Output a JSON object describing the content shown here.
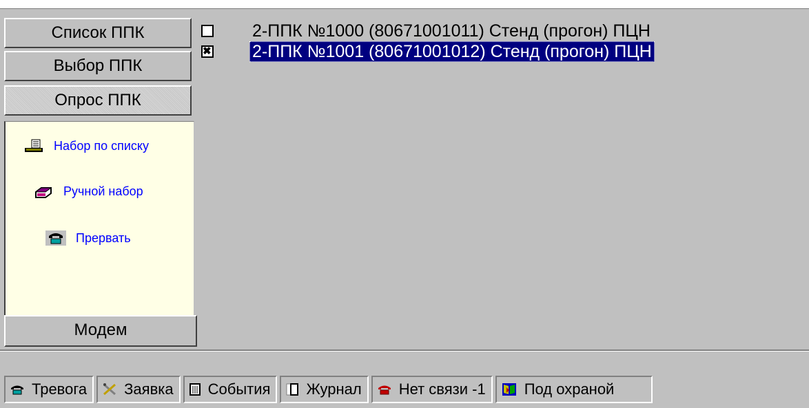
{
  "nav": {
    "list_label": "Список ППК",
    "select_label": "Выбор ППК",
    "poll_label": "Опрос ППК",
    "modem_label": "Модем"
  },
  "panel": {
    "items": [
      {
        "label": "Набор по списку",
        "icon": "list-dial-icon"
      },
      {
        "label": "Ручной набор",
        "icon": "manual-dial-icon"
      },
      {
        "label": "Прервать",
        "icon": "abort-icon"
      }
    ]
  },
  "devices": [
    {
      "label": "2-ППК №1000 (80671001011) Стенд (прогон) ПЦН",
      "checked": false,
      "selected": false
    },
    {
      "label": "2-ППК №1001 (80671001012) Стенд (прогон) ПЦН",
      "checked": true,
      "selected": true
    }
  ],
  "status": {
    "items": [
      {
        "label": "Тревога",
        "icon": "alarm-icon"
      },
      {
        "label": "Заявка",
        "icon": "request-tools-icon"
      },
      {
        "label": "События",
        "icon": "events-icon"
      },
      {
        "label": "Журнал",
        "icon": "journal-icon"
      },
      {
        "label": "Нет связи -1",
        "icon": "no-connection-phone-icon"
      },
      {
        "label": "Под охраной",
        "icon": "guarded-book-icon"
      }
    ]
  },
  "colors": {
    "selection": "#000080",
    "panel_bg": "#ffffe6",
    "link": "#0000ff"
  }
}
